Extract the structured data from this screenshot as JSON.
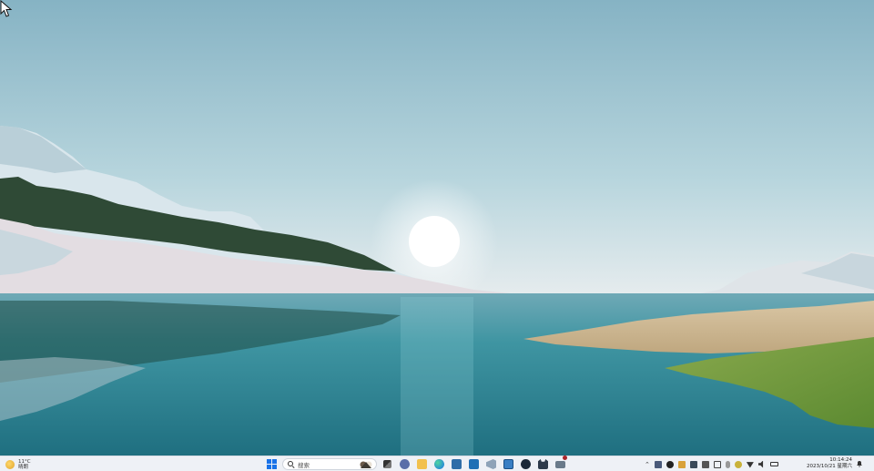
{
  "desktop": {
    "wallpaper": "lake-landscape-wallpaper",
    "colors": {
      "sky_top": "#7fb0c2",
      "sky_mid": "#b9d6de",
      "water": "#2f8a98",
      "grass": "#6f9a3e"
    }
  },
  "taskbar": {
    "weather": {
      "temperature": "11°C",
      "condition": "晴朗",
      "icon": "sun-icon"
    },
    "search": {
      "placeholder": "搜索"
    },
    "apps": [
      {
        "name": "start-button",
        "icon": "windows-logo-icon"
      },
      {
        "name": "task-view-button",
        "icon": "task-view-icon"
      },
      {
        "name": "chat-app",
        "icon": "chat-icon"
      },
      {
        "name": "file-explorer-app",
        "icon": "folder-icon"
      },
      {
        "name": "edge-app",
        "icon": "edge-icon"
      },
      {
        "name": "store-app",
        "icon": "store-icon"
      },
      {
        "name": "mail-app",
        "icon": "mail-icon"
      },
      {
        "name": "vscode-app",
        "icon": "vscode-icon"
      },
      {
        "name": "app-cube",
        "icon": "cube-icon"
      },
      {
        "name": "steam-app",
        "icon": "steam-icon"
      },
      {
        "name": "app-cat",
        "icon": "cat-icon"
      },
      {
        "name": "remote-desktop-app",
        "icon": "monitor-icon"
      }
    ],
    "tray": {
      "icons": [
        "chevron-up-icon",
        "app-tray-icon",
        "qq-icon",
        "app-tray-icon-2",
        "app-tray-icon-3",
        "input-icon",
        "keyboard-icon",
        "mic-icon",
        "app-tray-icon-4",
        "wifi-icon",
        "volume-icon",
        "battery-icon"
      ],
      "time": "10:14:24",
      "date": "2023/10/21 星期六"
    },
    "accent": "#1a73e8"
  }
}
